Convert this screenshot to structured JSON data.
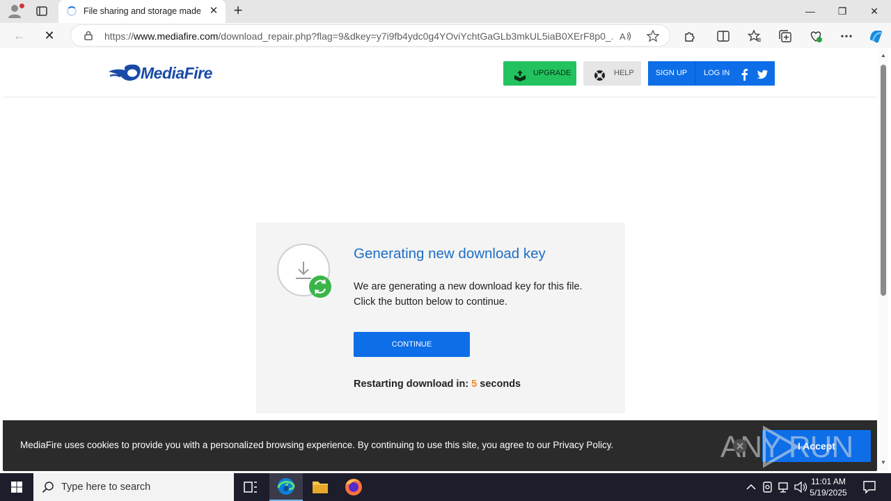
{
  "browser": {
    "tab_title": "File sharing and storage made simple",
    "new_tab_symbol": "+",
    "tab_close_symbol": "✕",
    "url_prefix": "https://",
    "url_domain": "www.mediafire.com",
    "url_rest": "/download_repair.php?flag=9&dkey=y7i9fb4ydc0g4YOviYchtGaGLb3mkUL5iaB0XErF8p0_...",
    "minimize_symbol": "—",
    "maximize_symbol": "❐",
    "close_symbol": "✕",
    "back_symbol": "←",
    "stop_symbol": "✕"
  },
  "site": {
    "logo_text": "MediaFire",
    "upgrade_label": "UPGRADE",
    "help_label": "HELP",
    "signup_label": "SIGN UP",
    "login_label": "LOG IN",
    "brand_blue": "#0d6ee8",
    "brand_green": "#22c35e"
  },
  "card": {
    "title": "Generating new download key",
    "description_line1": "We are generating a new download key for this file.",
    "description_line2": "Click the button below to continue.",
    "continue_label": "CONTINUE",
    "restart_prefix": "Restarting download in:",
    "restart_count": "5",
    "restart_suffix": "seconds",
    "count_color": "#f08b24"
  },
  "cookie_banner": {
    "message": "MediaFire uses cookies to provide you with a personalized browsing experience. By continuing to use this site, you agree to our Privacy Policy.",
    "accept_label": "I Accept"
  },
  "watermark": {
    "text": "ANY RUN"
  },
  "taskbar": {
    "search_placeholder": "Type here to search",
    "time": "11:01 AM",
    "date": "5/19/2025"
  }
}
